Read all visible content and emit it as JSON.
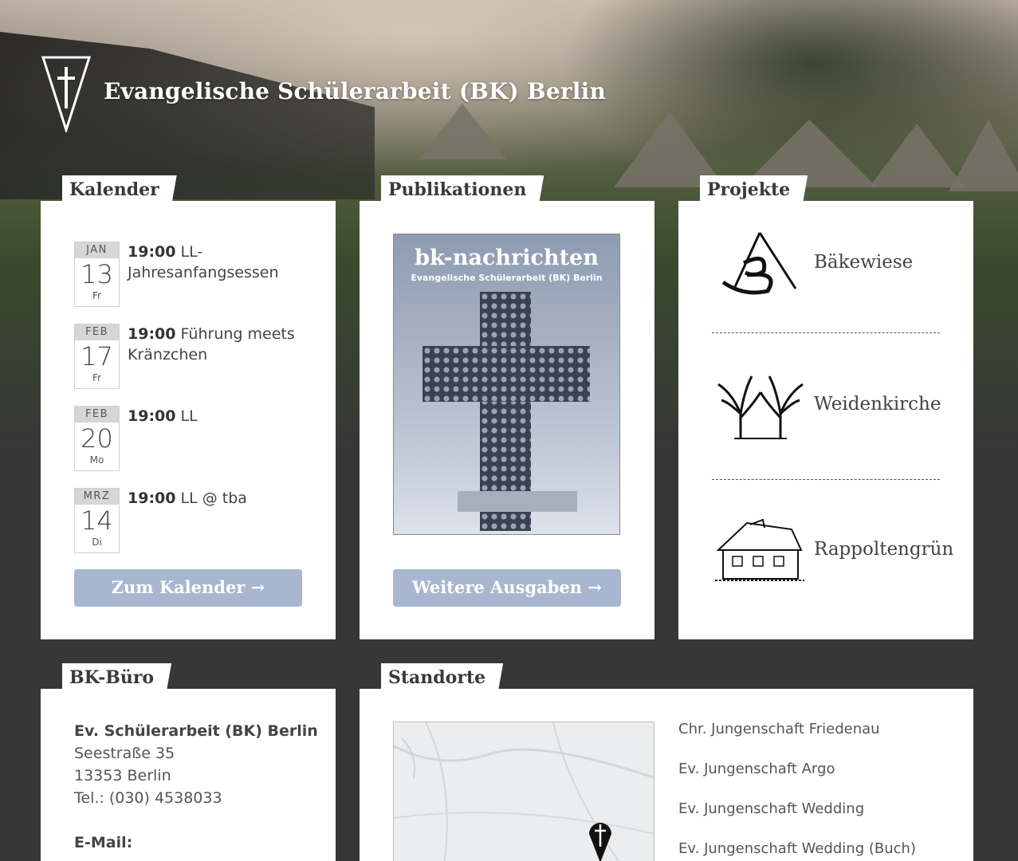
{
  "header": {
    "site_title": "Evangelische Schülerarbeit (BK) Berlin",
    "logo_icon": "cross-shield-icon"
  },
  "calendar": {
    "heading": "Kalender",
    "events": [
      {
        "month": "JAN",
        "day": "13",
        "weekday": "Fr",
        "time": "19:00",
        "title": "LL-Jahresanfangsessen"
      },
      {
        "month": "FEB",
        "day": "17",
        "weekday": "Fr",
        "time": "19:00",
        "title": "Führung meets Kränzchen"
      },
      {
        "month": "FEB",
        "day": "20",
        "weekday": "Mo",
        "time": "19:00",
        "title": "LL"
      },
      {
        "month": "MRZ",
        "day": "14",
        "weekday": "Di",
        "time": "19:00",
        "title": "LL @ tba"
      }
    ],
    "button_label": "Zum Kalender →"
  },
  "publications": {
    "heading": "Publikationen",
    "cover_title": "bk-nachrichten",
    "cover_subtitle": "Evangelische Schülerarbeit (BK) Berlin",
    "button_label": "Weitere Ausgaben →"
  },
  "projects": {
    "heading": "Projekte",
    "items": [
      {
        "name": "Bäkewiese",
        "icon": "baekewiese-logo-icon"
      },
      {
        "name": "Weidenkirche",
        "icon": "weidenkirche-logo-icon"
      },
      {
        "name": "Rappoltengrün",
        "icon": "house-sketch-icon"
      }
    ]
  },
  "office": {
    "heading": "BK-Büro",
    "org": "Ev. Schülerarbeit (BK) Berlin",
    "street": "Seestraße 35",
    "city": "13353 Berlin",
    "phone": "Tel.: (030) 4538033",
    "email_label": "E-Mail:"
  },
  "locations": {
    "heading": "Standorte",
    "items": [
      "Chr. Jungenschaft Friedenau",
      "Ev. Jungenschaft Argo",
      "Ev. Jungenschaft Wedding",
      "Ev. Jungenschaft Wedding (Buch)"
    ],
    "map_marker_icon": "cross-pin-icon"
  },
  "colors": {
    "button": "#a9b6cf",
    "background": "#373737"
  }
}
